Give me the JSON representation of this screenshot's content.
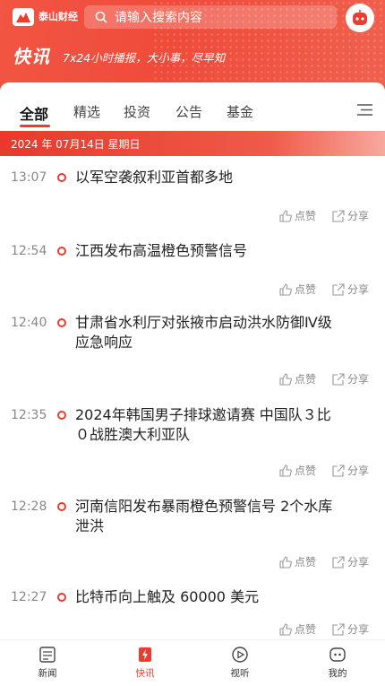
{
  "header": {
    "logo_text": "泰山财经",
    "search_placeholder": "请输入搜索内容",
    "brand": "快讯",
    "slogan": "7x24小时播报，大小事，尽早知"
  },
  "tabs": [
    "全部",
    "精选",
    "投资",
    "公告",
    "基金"
  ],
  "date_bar": "2024 年 07月14日 星期日",
  "actions": {
    "like": "点赞",
    "share": "分享"
  },
  "feed": [
    {
      "time": "13:07",
      "lines": [
        "以军空袭叙利亚首都多地"
      ]
    },
    {
      "time": "12:54",
      "lines": [
        "江西发布高温橙色预警信号"
      ]
    },
    {
      "time": "12:40",
      "lines": [
        "甘肃省水利厅对张掖市启动洪水防御Ⅳ级",
        "应急响应"
      ]
    },
    {
      "time": "12:35",
      "lines": [
        "2024年韩国男子排球邀请赛 中国队３比",
        "０战胜澳大利亚队"
      ]
    },
    {
      "time": "12:28",
      "lines": [
        "河南信阳发布暴雨橙色预警信号 2个水库",
        "泄洪"
      ]
    },
    {
      "time": "12:27",
      "lines": [
        "比特币向上触及 60000 美元"
      ]
    }
  ],
  "tabbar": [
    "新闻",
    "快讯",
    "视听",
    "我的"
  ],
  "colors": {
    "accent": "#e93d2f",
    "header": "#ef4b3b"
  }
}
